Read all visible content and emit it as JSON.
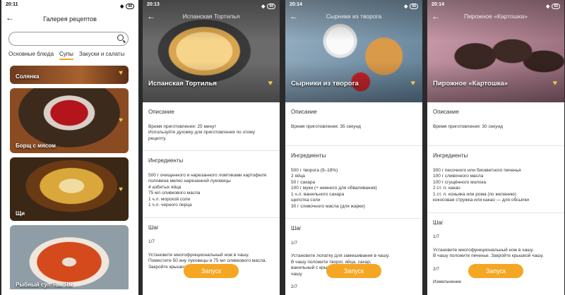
{
  "statusbar": {
    "p1_time": "20:11",
    "p2_time": "20:13",
    "p3_time": "20:14",
    "p4_time": "20:14",
    "battery": "66"
  },
  "gallery": {
    "title": "Галерея рецептов",
    "search_placeholder": "",
    "tabs": [
      "Основные блюда",
      "Супы",
      "Закуски и салаты"
    ],
    "active_tab": 1,
    "cards": [
      "Солянка",
      "Борщ с мясом",
      "Щи",
      "Рыбный суп Том Ям"
    ]
  },
  "launch_label": "Запуск",
  "tortilla": {
    "header_title": "Испанская Тортилья",
    "name": "Испанская Тортилья",
    "desc_title": "Описание",
    "desc": "Время приготовления: 25 минут\nИспользуйте духовку для приготовления по этому рецепту.",
    "ingr_title": "Ингредиенты",
    "ingr": "500 г очищенного и нарезанного ломтиками картофеля\nполовина мелко нарезанной луковицы\n4 азбитых яйца\n75 мл оливкового масла\n1 ч.л. морской соли\n1 ч.л. черного перца",
    "step_title": "Шаг",
    "step_num": "1/7",
    "step_text": "Установите многофункциональный нож в чашу.\nПоместите 50        ину луковицы и 75 мл оливкового масла. Закройте крышкой чашу."
  },
  "syrniki": {
    "header_title": "Сырники из творога",
    "name": "Сырники из творога",
    "desc_title": "Описание",
    "desc": "Время приготовления: 35 секунд",
    "ingr_title": "Ингредиенты",
    "ingr": "500 г творога (9–18%)\n2 яйца\n50 г сахара\n100 г муки (+ немного для обваливания)\n1 ч.л. ванильного сахара\nщепотка соли\n30 г сливочного масла (для жарки)",
    "step_title": "Шаг",
    "step_num": "1/7",
    "step_text": "Установите лопатку для замешивания в чашу.\nВ чашу положите творог, яйца, сахар,\nванильный с                    крышкой\nчашу.",
    "step_num2": "2/7"
  },
  "kartoshka": {
    "header_title": "Пирожное «Картошка»",
    "name": "Пирожное «Картошка»",
    "desc_title": "Описание",
    "desc": "Время приготовления:  30 секунд",
    "ingr_title": "Ингредиенты",
    "ingr": "300 г песочного или бисквитного печенья\n100 г сливочного масла\n100 г сгущённого молока\n2 ст. л. какао\n1 ст. л. коньяка или рома (по желанию)\nкокосовая стружка или какао — для обсыпки",
    "step_title": "Шаг",
    "step_num": "1/7",
    "step_text": "Установите многофункциональный нож в чашу.\nВ чашу положите печенье. Закройте крышкой чашу.",
    "step_num2": "2/7",
    "step_text2": "Измельчение"
  }
}
